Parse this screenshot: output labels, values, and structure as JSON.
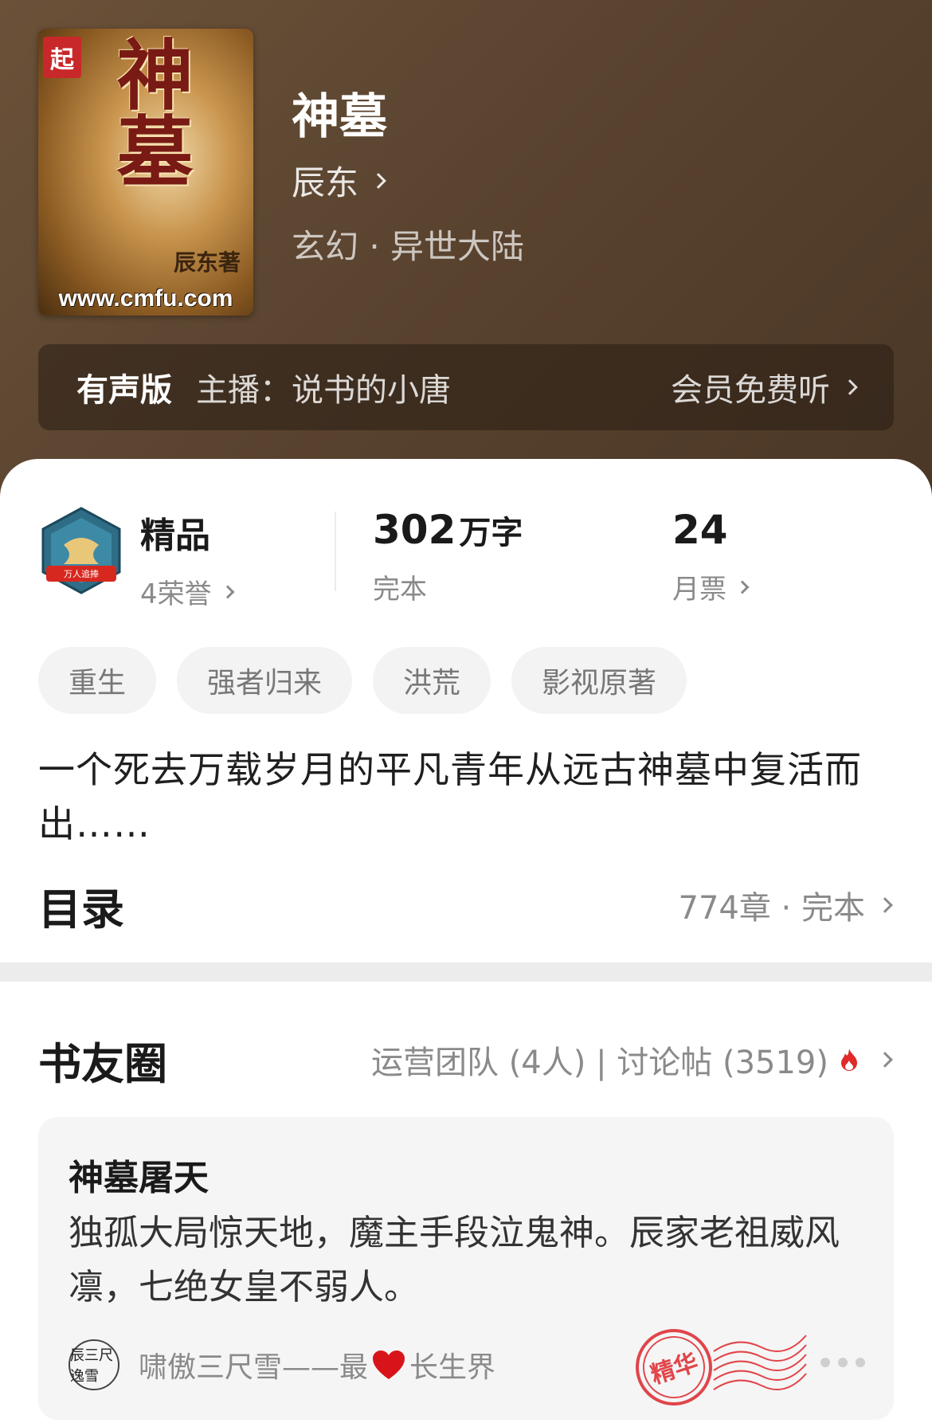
{
  "book": {
    "title": "神墓",
    "author": "辰东",
    "genre": "玄幻 · 异世大陆",
    "cover": {
      "seal_text": "起",
      "title_text": "神墓",
      "author_text": "辰东著",
      "url_text": "www.cmfu.com"
    }
  },
  "audio": {
    "tag": "有声版",
    "host": "主播：说书的小唐",
    "cta": "会员免费听"
  },
  "stats": {
    "quality": {
      "label": "精品",
      "sub": "4荣誉",
      "badge_text": "万人追捧"
    },
    "words": {
      "value": "302",
      "unit": "万字",
      "sub": "完本"
    },
    "votes": {
      "value": "24",
      "sub": "月票"
    }
  },
  "tags": [
    "重生",
    "强者归来",
    "洪荒",
    "影视原著"
  ],
  "description": "一个死去万载岁月的平凡青年从远古神墓中复活而出……",
  "toc": {
    "title": "目录",
    "info": "774章 · 完本"
  },
  "circle": {
    "title": "书友圈",
    "info": "运营团队 (4人) | 讨论帖 (3519)"
  },
  "post": {
    "title": "神墓屠天",
    "body": "独孤大局惊天地，魔主手段泣鬼神。辰家老祖威风凛，七绝女皇不弱人。",
    "user_prefix": "啸傲三尺雪——最",
    "user_suffix": "长生界",
    "avatar_text": "辰三尺逸雪",
    "stamp_text": "精华"
  },
  "colors": {
    "header_bg": "#5a4430",
    "accent_red": "#e02a2a",
    "muted": "#8a8a8a"
  }
}
